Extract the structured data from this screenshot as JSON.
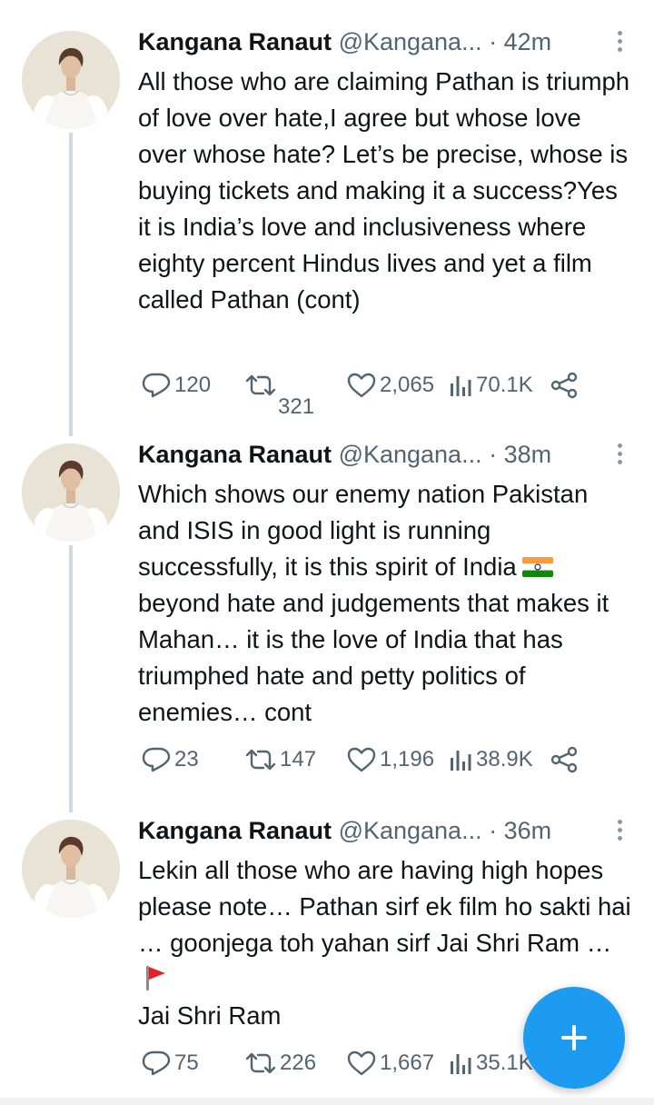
{
  "tweets": [
    {
      "name": "Kangana Ranaut",
      "handle": "@Kangana...",
      "dot": "·",
      "time": "42m",
      "text": "All those who are claiming Pathan is triumph of love over hate,I agree but whose love over whose hate? Let’s be precise, whose is buying tickets and making it a success?Yes it is India’s love and inclusiveness where eighty percent Hindus lives and yet a film called Pathan (cont)",
      "replies": "120",
      "retweets": "321",
      "likes": "2,065",
      "views": "70.1K"
    },
    {
      "name": "Kangana Ranaut",
      "handle": "@Kangana...",
      "dot": "·",
      "time": "38m",
      "text_a": "Which shows our enemy nation Pakistan and ISIS in good light is running successfully, it is this spirit of India",
      "text_b": "beyond hate and judgements that makes it Mahan… it is the love of India that has triumphed hate and petty politics of enemies… cont",
      "replies": "23",
      "retweets": "147",
      "likes": "1,196",
      "views": "38.9K"
    },
    {
      "name": "Kangana Ranaut",
      "handle": "@Kangana...",
      "dot": "·",
      "time": "36m",
      "text_a": "Lekin all those who are having high hopes please note… Pathan sirf ek film ho sakti hai … goonjega toh yahan sirf Jai Shri Ram …",
      "text_b": "Jai Shri Ram",
      "replies": "75",
      "retweets": "226",
      "likes": "1,667",
      "views": "35.1K"
    }
  ],
  "icons": {
    "reply": "reply-icon",
    "retweet": "retweet-icon",
    "like": "heart-icon",
    "views": "analytics-icon",
    "share": "share-icon",
    "more": "more-icon",
    "compose": "compose-plus-icon"
  },
  "colors": {
    "accent": "#1d9bf0",
    "text": "#0f1419",
    "secondary": "#536471",
    "thread_line": "#cfd9de"
  }
}
